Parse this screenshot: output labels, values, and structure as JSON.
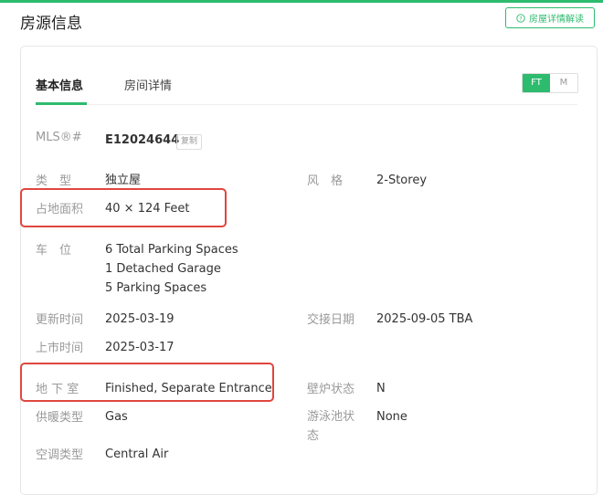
{
  "header": {
    "title": "房源信息",
    "guide_label": "房屋详情解读"
  },
  "tabs": [
    {
      "label": "基本信息",
      "active": true
    },
    {
      "label": "房间详情",
      "active": false
    }
  ],
  "unit_toggle": {
    "options": [
      "FT",
      "M"
    ],
    "selected": "FT"
  },
  "mls": {
    "label": "MLS®#",
    "value": "E12024644",
    "copy_label": "复制"
  },
  "fields": {
    "type": {
      "label": "类　型",
      "value": "独立屋"
    },
    "style": {
      "label": "风　格",
      "value": "2-Storey"
    },
    "lot_size": {
      "label": "占地面积",
      "value": "40 × 124 Feet"
    },
    "parking": {
      "label": "车　位",
      "lines": [
        "6 Total Parking Spaces",
        "1 Detached Garage",
        "5 Parking Spaces"
      ]
    },
    "updated": {
      "label": "更新时间",
      "value": "2025-03-19"
    },
    "closing": {
      "label": "交接日期",
      "value": "2025-09-05 TBA"
    },
    "listed": {
      "label": "上市时间",
      "value": "2025-03-17"
    },
    "basement": {
      "label": "地 下 室",
      "value": "Finished, Separate Entrance"
    },
    "fireplace": {
      "label": "壁炉状态",
      "value": "N"
    },
    "heating": {
      "label": "供暖类型",
      "value": "Gas"
    },
    "pool": {
      "label": "游泳池状态",
      "value": "None"
    },
    "ac": {
      "label": "空调类型",
      "value": "Central Air"
    }
  },
  "colors": {
    "accent": "#2dbb6e",
    "highlight": "#e0463e"
  }
}
